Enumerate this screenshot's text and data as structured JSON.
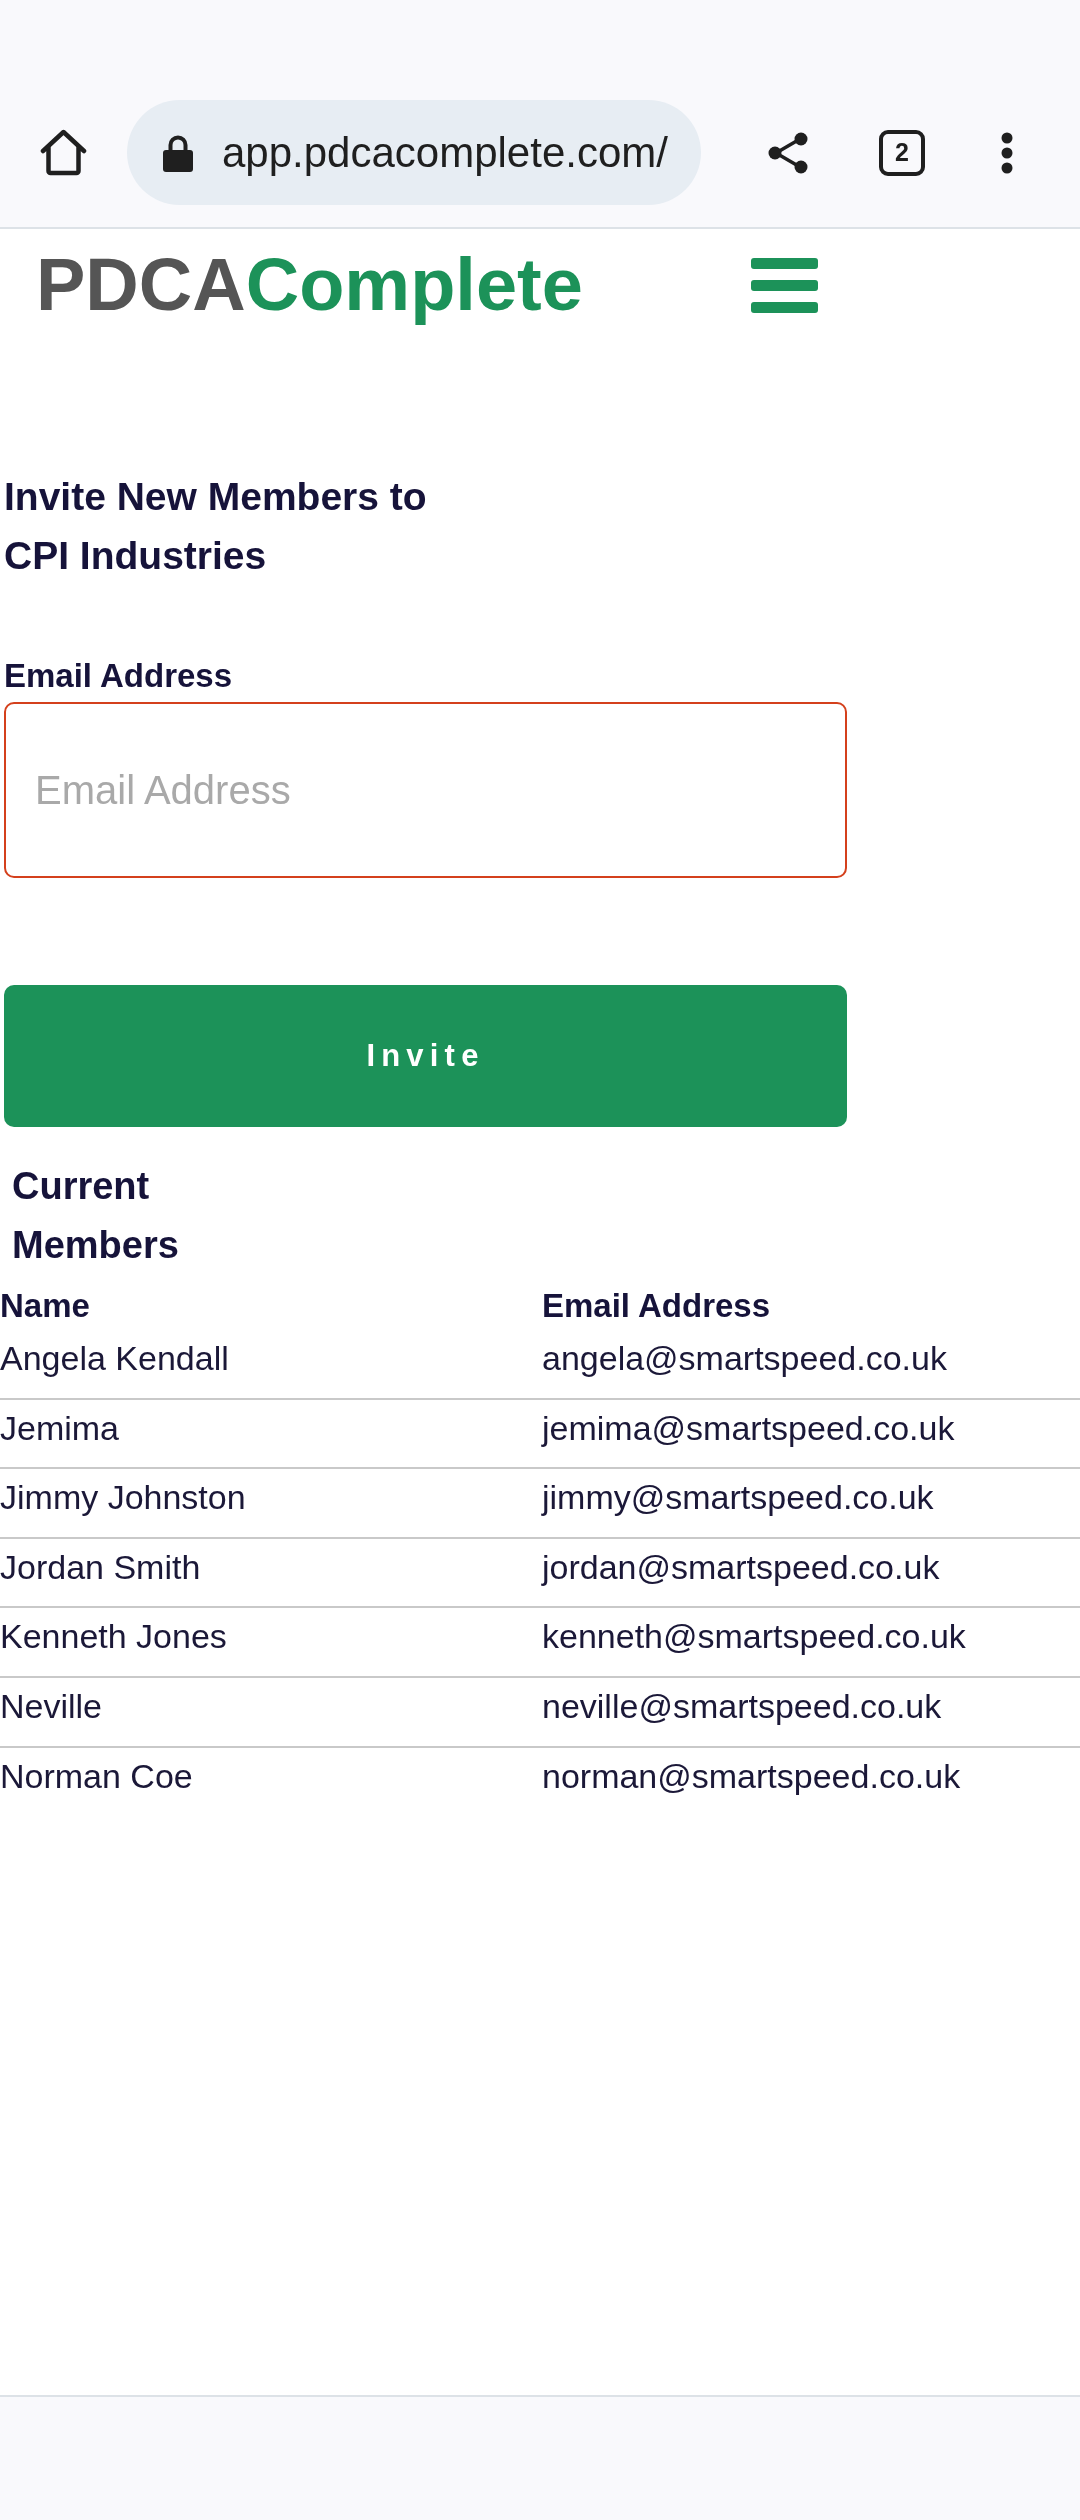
{
  "browser": {
    "url": "app.pdcacomplete.com/",
    "tab_count": "2"
  },
  "header": {
    "logo": {
      "part_1": "PDCA",
      "part_2": "Complete"
    }
  },
  "invite_form": {
    "title": "Invite New Members to CPI Industries",
    "email_field": {
      "label": "Email Address",
      "placeholder": "Email Address",
      "invalid": true
    },
    "button": "Invite"
  },
  "members": {
    "title": "Current Members",
    "table": {
      "columns": [
        "Name",
        "Email Address"
      ],
      "rows": [
        {
          "name": "Angela Kendall",
          "email": "angela@smartspeed.co.uk"
        },
        {
          "name": "Jemima",
          "email": "jemima@smartspeed.co.uk"
        },
        {
          "name": "Jimmy Johnston",
          "email": "jimmy@smartspeed.co.uk"
        },
        {
          "name": "Jordan Smith",
          "email": "jordan@smartspeed.co.uk"
        },
        {
          "name": "Kenneth Jones",
          "email": "kenneth@smartspeed.co.uk"
        },
        {
          "name": "Neville",
          "email": "neville@smartspeed.co.uk"
        },
        {
          "name": "Norman Coe",
          "email": "norman@smartspeed.co.uk"
        }
      ]
    }
  }
}
